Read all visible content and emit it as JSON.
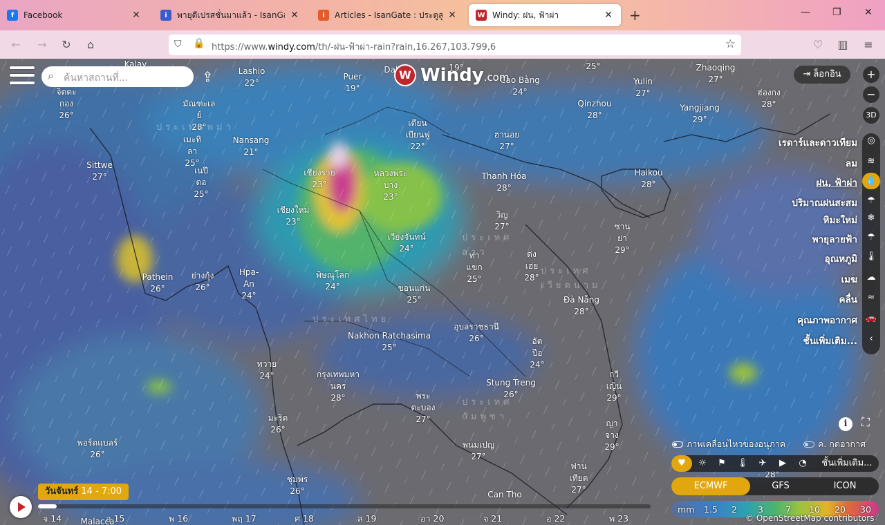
{
  "browser": {
    "tabs": [
      {
        "title": "Facebook",
        "favicon_color": "#1877f2",
        "favicon_char": "f",
        "active": false
      },
      {
        "title": "พายุดีเปรสชั่นมาแล้ว - IsanGate : ป",
        "favicon_color": "#3a5ccc",
        "favicon_char": "i",
        "active": false
      },
      {
        "title": "Articles - IsanGate : ประตูสู่อีสาน",
        "favicon_color": "#e25c2b",
        "favicon_char": "i",
        "active": false
      },
      {
        "title": "Windy: ฝน, ฟ้าผ่า",
        "favicon_color": "#c0262d",
        "favicon_char": "W",
        "active": true
      }
    ],
    "url_prefix": "https://www.",
    "url_domain": "windy.com",
    "url_path": "/th/-ฝน-ฟ้าผ่า-rain?rain,16.267,103.799,6"
  },
  "top": {
    "search_placeholder": "ค้นหาสถานที่...",
    "logo_main": "Windy",
    "logo_suffix": ".com",
    "login_label": "ล็อกอิน"
  },
  "zoom": {
    "plus": "+",
    "minus": "−",
    "threed": "3D"
  },
  "layers": [
    {
      "label": "เรดาร์และดาวเทียม",
      "icon": "globe-icon",
      "glyph": "◎",
      "active": false
    },
    {
      "label": "ลม",
      "icon": "wind-icon",
      "glyph": "≋",
      "active": false
    },
    {
      "label": "ฝน, ฟ้าผ่า",
      "icon": "raindrop-icon",
      "glyph": "💧",
      "active": true
    },
    {
      "label": "ปริมาณฝนสะสม",
      "icon": "rain-cloud-icon",
      "glyph": "☂",
      "active": false
    },
    {
      "label": "หิมะใหม่",
      "icon": "snowflake-icon",
      "glyph": "❄",
      "active": false
    },
    {
      "label": "พายุลายฟ้า",
      "icon": "umbrella-icon",
      "glyph": "☂",
      "active": false
    },
    {
      "label": "อุณหภูมิ",
      "icon": "thermometer-icon",
      "glyph": "🌡",
      "active": false
    },
    {
      "label": "เมฆ",
      "icon": "cloud-icon",
      "glyph": "☁",
      "active": false
    },
    {
      "label": "คลื่น",
      "icon": "waves-icon",
      "glyph": "≈",
      "active": false
    },
    {
      "label": "คุณภาพอากาศ",
      "icon": "car-icon",
      "glyph": "🚗",
      "active": false
    },
    {
      "label": "ชั้นเพิ่มเติม...",
      "icon": "chevron-left-icon",
      "glyph": "‹",
      "active": false
    }
  ],
  "toggles": {
    "particles": "ภาพเคลื่อนไหวของอนุภาค",
    "pressure": "ค. กดอากาศ"
  },
  "overlay_more": "ชั้นเพิ่มเติม...",
  "models": [
    {
      "label": "ECMWF",
      "active": true
    },
    {
      "label": "GFS",
      "active": false
    },
    {
      "label": "ICON",
      "active": false
    }
  ],
  "legend": {
    "unit": "mm",
    "ticks": [
      "1.5",
      "2",
      "3",
      "7",
      "10",
      "20",
      "30"
    ]
  },
  "attribution": "© OpenStreetMap contributors",
  "timeline": {
    "current_day": "วันจันทร์",
    "current_time": "14 - 7:00",
    "progress": 0.03,
    "days": [
      "จ 14",
      "อ 15",
      "พ 16",
      "พฤ 17",
      "ศ 18",
      "ส 19",
      "อา 20",
      "จ 21",
      "อ 22",
      "พ 23"
    ]
  },
  "map_labels": {
    "countries": [
      "ประเทศพม่า",
      "ประเทศลาว",
      "ประเทศเวียดนาม",
      "ประเทศไทย",
      "ประเทศกัมพูชา"
    ],
    "cities": [
      {
        "name": "Kalay",
        "temp": ""
      },
      {
        "name": "Lashio",
        "temp": "22°"
      },
      {
        "name": "Puer",
        "temp": "19°"
      },
      {
        "name": "Dali",
        "temp": ""
      },
      {
        "name": "",
        "temp": "19°"
      },
      {
        "name": "Cao Bằng",
        "temp": "24°"
      },
      {
        "name": "",
        "temp": "25°"
      },
      {
        "name": "Yulin",
        "temp": "27°"
      },
      {
        "name": "Zhaoqing",
        "temp": "27°"
      },
      {
        "name": "ฮ่องกง",
        "temp": "28°"
      },
      {
        "name": "จิตตะ\nกอง",
        "temp": "26°"
      },
      {
        "name": "มัณฑะเล\nย์",
        "temp": "28°"
      },
      {
        "name": "เมะทิ\nลา",
        "temp": "25°"
      },
      {
        "name": "เนปี\nดอ",
        "temp": "25°"
      },
      {
        "name": "Nansang",
        "temp": "21°"
      },
      {
        "name": "เดียน\nเบียนฟู",
        "temp": "22°"
      },
      {
        "name": "ฮานอย",
        "temp": "27°"
      },
      {
        "name": "Qinzhou",
        "temp": "28°"
      },
      {
        "name": "Yangjiang",
        "temp": "29°"
      },
      {
        "name": "Sittwe",
        "temp": "27°"
      },
      {
        "name": "เชียงราย",
        "temp": "23°"
      },
      {
        "name": "หลวงพระ\nบาง",
        "temp": "23°"
      },
      {
        "name": "Thanh Hóa",
        "temp": "28°"
      },
      {
        "name": "Haikou",
        "temp": "28°"
      },
      {
        "name": "เชียงใหม่",
        "temp": "23°"
      },
      {
        "name": "วิญ",
        "temp": "27°"
      },
      {
        "name": "ซาน\nย่า",
        "temp": "29°"
      },
      {
        "name": "เวียงจันทน์",
        "temp": "24°"
      },
      {
        "name": "ท่า\nแขก",
        "temp": "25°"
      },
      {
        "name": "ด่ง\nเฮ่ย",
        "temp": "28°"
      },
      {
        "name": "Pathein",
        "temp": "26°"
      },
      {
        "name": "ย่างกุ้ง",
        "temp": "26°"
      },
      {
        "name": "Hpa-\nAn",
        "temp": "24°"
      },
      {
        "name": "พิษณุโลก",
        "temp": "24°"
      },
      {
        "name": "ขอนแก่น",
        "temp": "25°"
      },
      {
        "name": "Đà Nẵng",
        "temp": "28°"
      },
      {
        "name": "อุบลราชธานี",
        "temp": "26°"
      },
      {
        "name": "Nakhon Ratchasima",
        "temp": "25°"
      },
      {
        "name": "อัต\nปือ",
        "temp": "24°"
      },
      {
        "name": "ทวาย",
        "temp": "24°"
      },
      {
        "name": "กรุงเทพมหา\nนคร",
        "temp": "28°"
      },
      {
        "name": "Stung Treng",
        "temp": "26°"
      },
      {
        "name": "กวี\nเญิน",
        "temp": "29°"
      },
      {
        "name": "มะริด",
        "temp": "26°"
      },
      {
        "name": "พระ\nตะบอง",
        "temp": "27°"
      },
      {
        "name": "ญา\nจาง",
        "temp": "29°"
      },
      {
        "name": "พอร์ตแบลร์",
        "temp": "26°"
      },
      {
        "name": "พนมเปญ",
        "temp": "27°"
      },
      {
        "name": "ฟาน\nเทียต",
        "temp": "27°"
      },
      {
        "name": "ชุมพร",
        "temp": "26°"
      },
      {
        "name": "Can Tho",
        "temp": ""
      },
      {
        "name": "",
        "temp": "28°"
      },
      {
        "name": "Malacca",
        "temp": ""
      }
    ]
  },
  "colors": {
    "accent": "#e2a60f",
    "windy_red": "#c0262d"
  }
}
